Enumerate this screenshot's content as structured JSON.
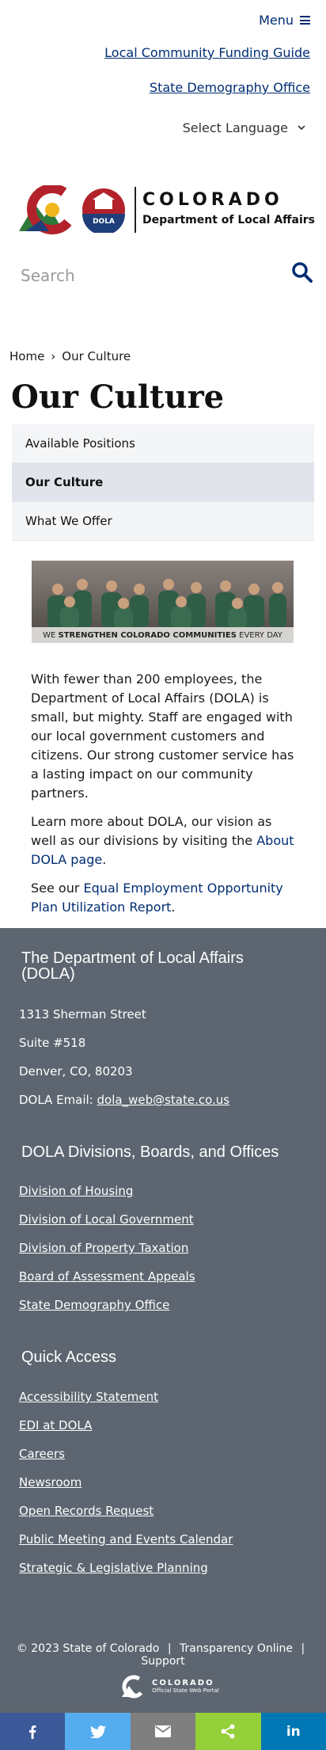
{
  "header": {
    "menu_label": "Menu",
    "links": [
      "Local Community Funding Guide",
      "State Demography Office"
    ],
    "language_label": "Select Language"
  },
  "logo": {
    "name": "COLORADO",
    "department": "Department of Local Affairs",
    "badge": "DOLA"
  },
  "search": {
    "placeholder": "Search"
  },
  "breadcrumb": {
    "home": "Home",
    "current": "Our Culture"
  },
  "page_title": "Our Culture",
  "subnav": [
    {
      "label": "Available Positions",
      "active": false
    },
    {
      "label": "Our Culture",
      "active": true
    },
    {
      "label": "What We Offer",
      "active": false
    }
  ],
  "banner": {
    "pre": "WE",
    "strong": "STRENGTHEN COLORADO COMMUNITIES",
    "post": "EVERY DAY"
  },
  "content": {
    "p1": "With fewer than 200 employees, the Department of Local Affairs (DOLA) is small, but mighty. Staff are engaged with our local government customers and citizens. Our strong customer service has a lasting impact on our community partners.",
    "p2_pre": "Learn more about DOLA, our vision as well as our divisions by visiting the ",
    "p2_link": "About DOLA page",
    "p2_post": ".",
    "p3_pre": "See our ",
    "p3_link": "Equal Employment Opportunity Plan Utilization Report",
    "p3_post": "."
  },
  "footer": {
    "org_heading": "The Department of Local Affairs (DOLA)",
    "address_1": "1313 Sherman Street",
    "address_2": "Suite  #518",
    "address_3": "Denver, CO, 80203",
    "email_label": "DOLA Email: ",
    "email": "dola_web@state.co.us",
    "divisions_heading": "DOLA Divisions, Boards, and Offices",
    "divisions": [
      "Division of Housing",
      "Division of Local Government",
      "Division of Property Taxation",
      "Board of Assessment Appeals",
      "State Demography Office"
    ],
    "quick_heading": "Quick Access",
    "quick_links": [
      "Accessibility Statement",
      "EDI at DOLA",
      "Careers",
      "Newsroom",
      "Open Records Request",
      "Public Meeting and Events Calendar",
      "Strategic & Legislative Planning"
    ],
    "copyright": "© 2023 State of Colorado",
    "sep": "|",
    "transparency": "Transparency Online",
    "support": "Support",
    "portal_name": "COLORADO",
    "portal_sub": "Official State Web Portal"
  },
  "share_bar": [
    {
      "icon": "facebook-icon",
      "color": "#3b5998"
    },
    {
      "icon": "twitter-icon",
      "color": "#55acee"
    },
    {
      "icon": "email-icon",
      "color": "#7f7f7f"
    },
    {
      "icon": "share-icon",
      "color": "#95d03a"
    },
    {
      "icon": "linkedin-icon",
      "color": "#0077b5"
    }
  ],
  "colors": {
    "link": "#002D72",
    "footer_bg": "#5d6670",
    "active_nav_bg": "#e1e4ea",
    "nav_bg": "#f4f5f7"
  }
}
